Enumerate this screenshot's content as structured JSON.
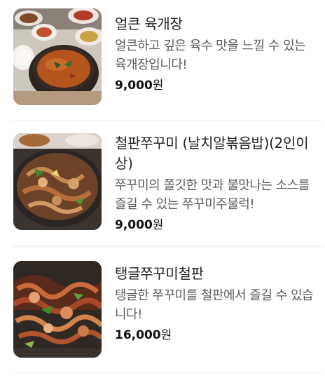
{
  "menu": {
    "items": [
      {
        "name": "얼큰 육개장",
        "description": "얼큰하고 깊은 육수 맛을 느낄 수 있는 육개장입니다!",
        "price": "9,000",
        "currency": "원",
        "image": "food-photo-spicy-beef-soup"
      },
      {
        "name": "철판쭈꾸미 (날치알볶음밥)(2인이상)",
        "description": "쭈꾸미의 쫄깃한 맛과 불맛나는 소스를 즐길 수 있는 쭈꾸미주물럭!",
        "price": "9,000",
        "currency": "원",
        "image": "food-photo-webfoot-octopus-skillet"
      },
      {
        "name": "탱글쭈꾸미철판",
        "description": "탱글한 쭈꾸미를 철판에서 즐길 수 있습니다!",
        "price": "16,000",
        "currency": "원",
        "image": "food-photo-octopus-stirfry"
      }
    ]
  }
}
